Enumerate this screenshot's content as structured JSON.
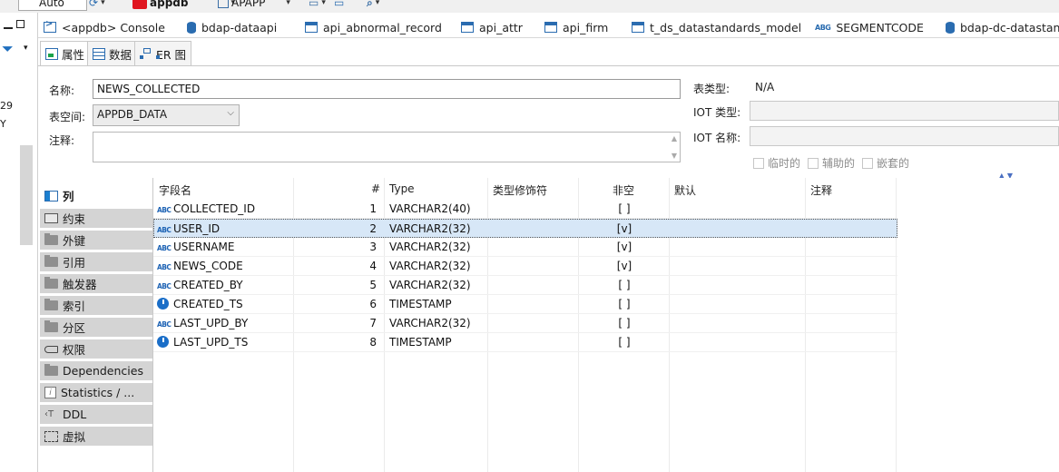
{
  "toolbar": {
    "mode": "Auto",
    "database": "appdb",
    "schema": "APAPP"
  },
  "left_strip": {
    "line1": "29",
    "line2": "Y"
  },
  "editor_tabs": [
    {
      "label": "<appdb> Console",
      "icon": "console-icon"
    },
    {
      "label": "bdap-dataapi",
      "icon": "database-icon"
    },
    {
      "label": "api_abnormal_record",
      "icon": "table-icon"
    },
    {
      "label": "api_attr",
      "icon": "table-icon"
    },
    {
      "label": "api_firm",
      "icon": "table-icon"
    },
    {
      "label": "t_ds_datastandards_model",
      "icon": "table-icon"
    },
    {
      "label": "SEGMENTCODE",
      "icon": "sequence-icon"
    },
    {
      "label": "bdap-dc-datastan",
      "icon": "database-icon"
    }
  ],
  "sub_tabs": [
    {
      "label": "属性",
      "active": true
    },
    {
      "label": "数据",
      "active": false
    },
    {
      "label": "ER 图",
      "active": false
    }
  ],
  "form": {
    "name_label": "名称:",
    "name_value": "NEWS_COLLECTED",
    "tablespace_label": "表空间:",
    "tablespace_value": "APPDB_DATA",
    "comment_label": "注释:",
    "comment_value": "",
    "table_type_label": "表类型:",
    "table_type_value": "N/A",
    "iot_type_label": "IOT 类型:",
    "iot_type_value": "",
    "iot_name_label": "IOT 名称:",
    "iot_name_value": "",
    "temporary_label": "临时的",
    "secondary_label": "辅助的",
    "nested_label": "嵌套的"
  },
  "nav": [
    {
      "label": "列",
      "icon": "columns-icon",
      "active": true
    },
    {
      "label": "约束",
      "icon": "constraint-icon",
      "active": false
    },
    {
      "label": "外键",
      "icon": "folder-icon",
      "active": false
    },
    {
      "label": "引用",
      "icon": "folder-icon",
      "active": false
    },
    {
      "label": "触发器",
      "icon": "folder-icon",
      "active": false
    },
    {
      "label": "索引",
      "icon": "folder-icon",
      "active": false
    },
    {
      "label": "分区",
      "icon": "folder-icon",
      "active": false
    },
    {
      "label": "权限",
      "icon": "key-icon",
      "active": false
    },
    {
      "label": "Dependencies",
      "icon": "folder-icon",
      "active": false
    },
    {
      "label": "Statistics / ...",
      "icon": "info-icon",
      "active": false
    },
    {
      "label": "DDL",
      "icon": "ddl-icon",
      "active": false
    },
    {
      "label": "虚拟",
      "icon": "virtual-icon",
      "active": false
    }
  ],
  "columns_table": {
    "headers": [
      "字段名",
      "#",
      "Type",
      "类型修饰符",
      "非空",
      "默认",
      "注释"
    ],
    "rows": [
      {
        "name": "COLLECTED_ID",
        "kind": "text",
        "num": "1",
        "type": "VARCHAR2(40)",
        "modifier": "",
        "not_null": "[ ]",
        "default": "",
        "comment": ""
      },
      {
        "name": "USER_ID",
        "kind": "text",
        "num": "2",
        "type": "VARCHAR2(32)",
        "modifier": "",
        "not_null": "[v]",
        "default": "",
        "comment": "",
        "selected": true
      },
      {
        "name": "USERNAME",
        "kind": "text",
        "num": "3",
        "type": "VARCHAR2(32)",
        "modifier": "",
        "not_null": "[v]",
        "default": "",
        "comment": ""
      },
      {
        "name": "NEWS_CODE",
        "kind": "text",
        "num": "4",
        "type": "VARCHAR2(32)",
        "modifier": "",
        "not_null": "[v]",
        "default": "",
        "comment": ""
      },
      {
        "name": "CREATED_BY",
        "kind": "text",
        "num": "5",
        "type": "VARCHAR2(32)",
        "modifier": "",
        "not_null": "[ ]",
        "default": "",
        "comment": ""
      },
      {
        "name": "CREATED_TS",
        "kind": "time",
        "num": "6",
        "type": "TIMESTAMP",
        "modifier": "",
        "not_null": "[ ]",
        "default": "",
        "comment": ""
      },
      {
        "name": "LAST_UPD_BY",
        "kind": "text",
        "num": "7",
        "type": "VARCHAR2(32)",
        "modifier": "",
        "not_null": "[ ]",
        "default": "",
        "comment": ""
      },
      {
        "name": "LAST_UPD_TS",
        "kind": "time",
        "num": "8",
        "type": "TIMESTAMP",
        "modifier": "",
        "not_null": "[ ]",
        "default": "",
        "comment": ""
      }
    ]
  },
  "colors": {
    "accent": "#2a6cb0",
    "selected_row": "#d7e7f7",
    "nav_bg": "#d4d4d4",
    "brand_red": "#e0151f"
  }
}
